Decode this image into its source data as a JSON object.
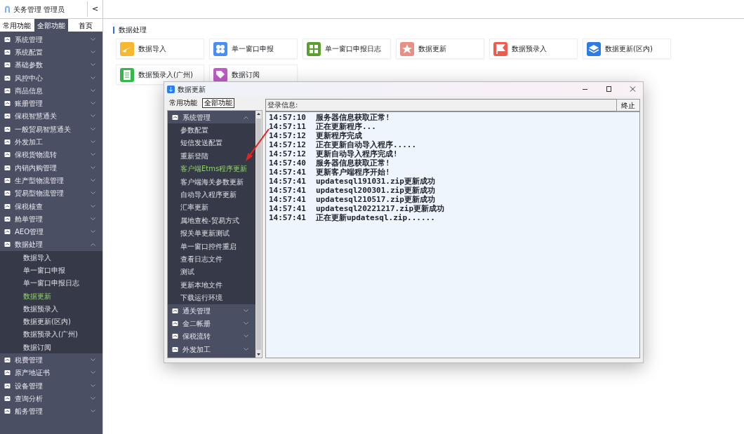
{
  "header": {
    "title": "关务管理 管理员",
    "collapse": "<"
  },
  "sidebar_tabs": [
    {
      "label": "常用功能",
      "selected": false
    },
    {
      "label": "全部功能",
      "selected": true
    },
    {
      "label": "首页",
      "selected": false
    }
  ],
  "sidebar": {
    "items": [
      {
        "label": "系统管理",
        "expanded": false
      },
      {
        "label": "系统配置",
        "expanded": false
      },
      {
        "label": "基础参数",
        "expanded": false
      },
      {
        "label": "风控中心",
        "expanded": false
      },
      {
        "label": "商品信息",
        "expanded": false
      },
      {
        "label": "账册管理",
        "expanded": false
      },
      {
        "label": "保税智慧通关",
        "expanded": false
      },
      {
        "label": "一般贸易智慧通关",
        "expanded": false
      },
      {
        "label": "外发加工",
        "expanded": false
      },
      {
        "label": "保税货物流转",
        "expanded": false
      },
      {
        "label": "内销内购管理",
        "expanded": false
      },
      {
        "label": "生产型物流管理",
        "expanded": false
      },
      {
        "label": "贸易型物流管理",
        "expanded": false
      },
      {
        "label": "保税核查",
        "expanded": false
      },
      {
        "label": "舱单管理",
        "expanded": false
      },
      {
        "label": "AEO管理",
        "expanded": false
      },
      {
        "label": "数据处理",
        "expanded": true,
        "children": [
          {
            "label": "数据导入",
            "selected": false
          },
          {
            "label": "单一窗口申报",
            "selected": false
          },
          {
            "label": "单一窗口申报日志",
            "selected": false
          },
          {
            "label": "数据更新",
            "selected": true
          },
          {
            "label": "数据预录入",
            "selected": false
          },
          {
            "label": "数据更新(区内)",
            "selected": false
          },
          {
            "label": "数据预录入(广州)",
            "selected": false
          },
          {
            "label": "数据订阅",
            "selected": false
          }
        ]
      },
      {
        "label": "税费管理",
        "expanded": false
      },
      {
        "label": "原产地证书",
        "expanded": false
      },
      {
        "label": "设备管理",
        "expanded": false
      },
      {
        "label": "查询分析",
        "expanded": false
      },
      {
        "label": "船务管理",
        "expanded": false
      }
    ]
  },
  "section_title": "数据处理",
  "tiles": [
    {
      "label": "数据导入",
      "color": "#f5b82e"
    },
    {
      "label": "单一窗口申报",
      "color": "#4a8ef5"
    },
    {
      "label": "单一窗口申报日志",
      "color": "#5aa02c"
    },
    {
      "label": "数据更新",
      "color": "#e88f86"
    },
    {
      "label": "数据预录入",
      "color": "#f15b4b"
    },
    {
      "label": "数据更新(区内)",
      "color": "#2d7be5"
    },
    {
      "label": "数据预录入(广州)",
      "color": "#33b94a"
    },
    {
      "label": "数据订阅",
      "color": "#c05cc8"
    }
  ],
  "dialog": {
    "title": "数据更新",
    "tabs": [
      {
        "label": "常用功能",
        "selected": false
      },
      {
        "label": "全部功能",
        "selected": true
      }
    ],
    "tree": [
      {
        "label": "系统管理",
        "expanded": true,
        "children": [
          {
            "label": "参数配置",
            "selected": false
          },
          {
            "label": "短信发送配置",
            "selected": false
          },
          {
            "label": "重新登陆",
            "selected": false
          },
          {
            "label": "客户端Etms程序更新",
            "selected": true
          },
          {
            "label": "客户端海关参数更新",
            "selected": false
          },
          {
            "label": "自动导入程序更新",
            "selected": false
          },
          {
            "label": "汇率更新",
            "selected": false
          },
          {
            "label": "属地查检-贸易方式",
            "selected": false
          },
          {
            "label": "报关单更新测试",
            "selected": false
          },
          {
            "label": "单一窗口控件重启",
            "selected": false
          },
          {
            "label": "查看日志文件",
            "selected": false
          },
          {
            "label": "测试",
            "selected": false
          },
          {
            "label": "更新本地文件",
            "selected": false
          },
          {
            "label": "下载运行环境",
            "selected": false
          }
        ]
      },
      {
        "label": "通关管理",
        "expanded": false
      },
      {
        "label": "金二帐册",
        "expanded": false
      },
      {
        "label": "保税流转",
        "expanded": false
      },
      {
        "label": "外发加工",
        "expanded": false
      }
    ],
    "login_label": "登录信息:",
    "stop_button": "终止",
    "log": [
      {
        "time": "14:57:10",
        "message": "服务器信息获取正常!"
      },
      {
        "time": "14:57:11",
        "message": "正在更新程序..."
      },
      {
        "time": "14:57:12",
        "message": "更新程序完成"
      },
      {
        "time": "14:57:12",
        "message": "正在更新自动导入程序....."
      },
      {
        "time": "14:57:12",
        "message": "更新自动导入程序完成!"
      },
      {
        "time": "14:57:40",
        "message": "服务器信息获取正常!"
      },
      {
        "time": "14:57:41",
        "message": "更新客户端程序开始!"
      },
      {
        "time": "14:57:41",
        "message": "updatesql191031.zip更新成功"
      },
      {
        "time": "14:57:41",
        "message": "updatesql200301.zip更新成功"
      },
      {
        "time": "14:57:41",
        "message": "updatesql210517.zip更新成功"
      },
      {
        "time": "14:57:41",
        "message": "updatesql20221217.zip更新成功"
      },
      {
        "time": "14:57:41",
        "message": "正在更新updatesql.zip......"
      }
    ]
  }
}
